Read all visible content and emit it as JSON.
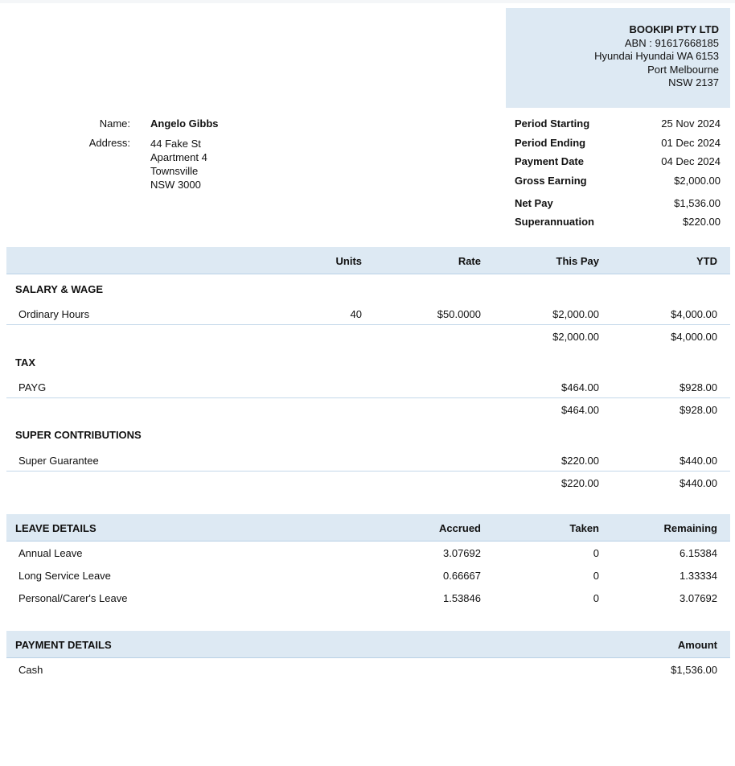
{
  "company": {
    "name": "BOOKIPI PTY LTD",
    "abn": "ABN : 91617668185",
    "address1": "Hyundai Hyundai WA 6153",
    "address2": "Port Melbourne",
    "address3": "NSW 2137"
  },
  "employee": {
    "name_label": "Name:",
    "name": "Angelo Gibbs",
    "address_label": "Address:",
    "address_lines": [
      "44 Fake St",
      "Apartment 4",
      "Townsville",
      "NSW 3000"
    ]
  },
  "summary": [
    {
      "label": "Period Starting",
      "value": "25 Nov 2024"
    },
    {
      "label": "Period Ending",
      "value": "01 Dec 2024"
    },
    {
      "label": "Payment Date",
      "value": "04 Dec 2024"
    },
    {
      "label": "Gross Earning",
      "value": "$2,000.00"
    },
    {
      "label": "Net Pay",
      "value": "$1,536.00"
    },
    {
      "label": "Superannuation",
      "value": "$220.00"
    }
  ],
  "earnings_header": {
    "units": "Units",
    "rate": "Rate",
    "this_pay": "This Pay",
    "ytd": "YTD"
  },
  "sections": [
    {
      "title": "SALARY & WAGE",
      "item": {
        "name": "Ordinary Hours",
        "units": "40",
        "rate": "$50.0000",
        "this_pay": "$2,000.00",
        "ytd": "$4,000.00"
      },
      "total": {
        "this_pay": "$2,000.00",
        "ytd": "$4,000.00"
      }
    },
    {
      "title": "TAX",
      "item": {
        "name": "PAYG",
        "units": "",
        "rate": "",
        "this_pay": "$464.00",
        "ytd": "$928.00"
      },
      "total": {
        "this_pay": "$464.00",
        "ytd": "$928.00"
      }
    },
    {
      "title": "SUPER CONTRIBUTIONS",
      "item": {
        "name": "Super Guarantee",
        "units": "",
        "rate": "",
        "this_pay": "$220.00",
        "ytd": "$440.00"
      },
      "total": {
        "this_pay": "$220.00",
        "ytd": "$440.00"
      }
    }
  ],
  "leave": {
    "header": {
      "title": "LEAVE DETAILS",
      "accrued": "Accrued",
      "taken": "Taken",
      "remaining": "Remaining"
    },
    "rows": [
      {
        "name": "Annual Leave",
        "accrued": "3.07692",
        "taken": "0",
        "remaining": "6.15384"
      },
      {
        "name": "Long Service Leave",
        "accrued": "0.66667",
        "taken": "0",
        "remaining": "1.33334"
      },
      {
        "name": "Personal/Carer's Leave",
        "accrued": "1.53846",
        "taken": "0",
        "remaining": "3.07692"
      }
    ]
  },
  "payment": {
    "header": {
      "title": "PAYMENT DETAILS",
      "amount": "Amount"
    },
    "rows": [
      {
        "method": "Cash",
        "amount": "$1,536.00"
      }
    ]
  }
}
